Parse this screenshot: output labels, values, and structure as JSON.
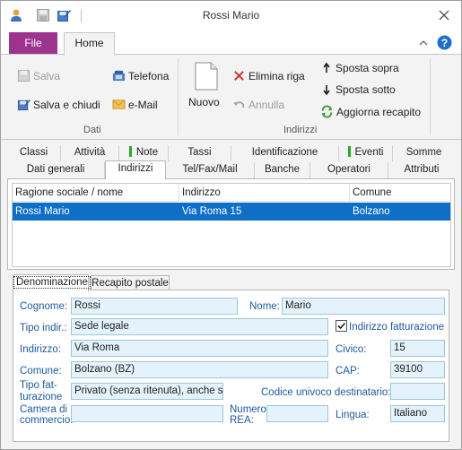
{
  "window": {
    "title": "Rossi Mario"
  },
  "ribbon": {
    "tabs": {
      "file": "File",
      "home": "Home"
    },
    "groups": {
      "dati": {
        "label": "Dati",
        "salva": "Salva",
        "salva_chiudi": "Salva e chiudi",
        "telefona": "Telefona",
        "email": "e-Mail"
      },
      "indirizzi": {
        "label": "Indirizzi",
        "nuovo": "Nuovo",
        "elimina_riga": "Elimina riga",
        "annulla": "Annulla",
        "sposta_sopra": "Sposta sopra",
        "sposta_sotto": "Sposta sotto",
        "aggiorna_recapito": "Aggiorna recapito"
      }
    }
  },
  "detail_tabs": {
    "row1": [
      "Classi",
      "Attività",
      "Note",
      "Tassi",
      "Identificazione",
      "Eventi",
      "Somme"
    ],
    "row2": [
      "Dati generali",
      "Indirizzi",
      "Tel/Fax/Mail",
      "Banche",
      "Operatori",
      "Attributi"
    ]
  },
  "address_list": {
    "columns": [
      "Ragione sociale / nome",
      "Indirizzo",
      "Comune"
    ],
    "rows": [
      {
        "nome": "Rossi Mario",
        "indirizzo": "Via Roma 15",
        "comune": "Bolzano"
      }
    ]
  },
  "form": {
    "tabs": [
      "Denominazione",
      "Recapito postale"
    ],
    "labels": {
      "cognome": "Cognome:",
      "nome": "Nome:",
      "tipo_indir": "Tipo indir.:",
      "indirizzo_fatturazione": "Indirizzo fatturazione",
      "indirizzo": "Indirizzo:",
      "civico": "Civico:",
      "comune": "Comune:",
      "cap": "CAP:",
      "tipo_fatturazione_1": "Tipo fat-",
      "tipo_fatturazione_2": "turazione",
      "codice_univoco": "Codice univoco destinatario:",
      "camera_1": "Camera di",
      "camera_2": "commercio:",
      "numero_rea_1": "Numero",
      "numero_rea_2": "REA:",
      "lingua": "Lingua:"
    },
    "values": {
      "cognome": "Rossi",
      "nome": "Mario",
      "tipo_indir": "Sede legale",
      "indirizzo_fatturazione_checked": true,
      "indirizzo": "Via Roma",
      "civico": "15",
      "comune": "Bolzano (BZ)",
      "cap": "39100",
      "tipo_fatturazione": "Privato (senza ritenuta), anche se",
      "codice_univoco": "",
      "camera": "",
      "numero_rea": "",
      "lingua": "Italiano"
    }
  },
  "colors": {
    "file_tab": "#9c338f",
    "selection": "#0f6fc6",
    "field_bg": "#e4f3fb",
    "label_text": "#1e5aa0",
    "help": "#1e6fc9",
    "delete_red": "#d42b2b"
  }
}
